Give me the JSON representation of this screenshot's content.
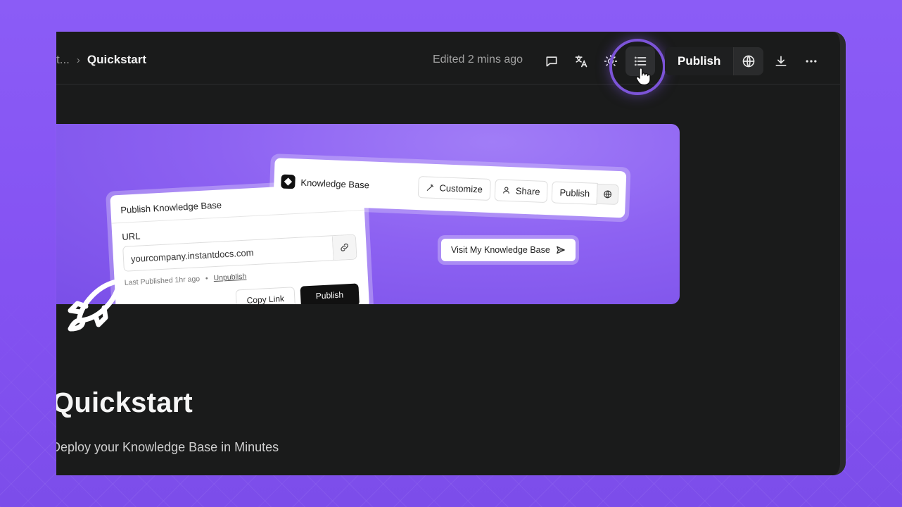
{
  "breadcrumb": {
    "truncated": "t...",
    "separator": "›",
    "current": "Quickstart"
  },
  "toolbar": {
    "edited_status": "Edited 2 mins ago",
    "comment_icon": "comment-icon",
    "translate_icon": "translate-icon",
    "theme_icon": "sun-icon",
    "toc_icon": "list-icon",
    "publish_label": "Publish",
    "globe_icon": "globe-icon",
    "download_icon": "download-icon",
    "more_icon": "more-icon"
  },
  "banner": {
    "kb_card": {
      "title": "Knowledge Base",
      "customize": "Customize",
      "share": "Share",
      "publish": "Publish"
    },
    "publish_card": {
      "title": "Publish Knowledge Base",
      "url_label": "URL",
      "url_value": "yourcompany.instantdocs.com",
      "last_published": "Last Published 1hr ago",
      "dot": "•",
      "unpublish": "Unpublish",
      "copy_link": "Copy Link",
      "publish": "Publish"
    },
    "visit_button": "Visit My Knowledge Base"
  },
  "page": {
    "title": "Quickstart",
    "subtitle": "Deploy your Knowledge Base in Minutes"
  },
  "colors": {
    "accent": "#8b5cf6",
    "panel": "#1a1b1b",
    "ring": "#7c54d8"
  }
}
